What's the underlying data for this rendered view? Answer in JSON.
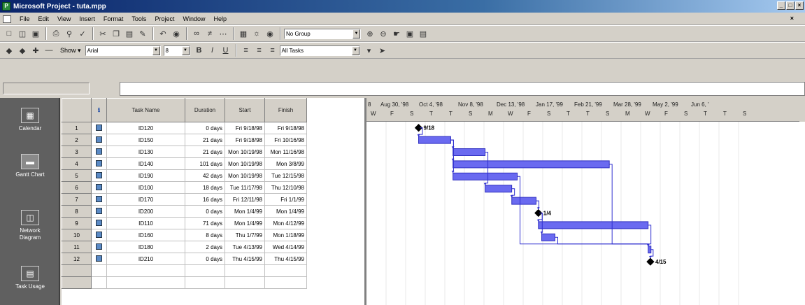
{
  "window": {
    "title": "Microsoft Project - tuta.mpp",
    "min": "_",
    "max": "□",
    "close": "×"
  },
  "menu": [
    "File",
    "Edit",
    "View",
    "Insert",
    "Format",
    "Tools",
    "Project",
    "Window",
    "Help"
  ],
  "toolbar1": {
    "group_combo": "No Group"
  },
  "toolbar2": {
    "show_label": "Show ▾",
    "font_combo": "Arial",
    "size_combo": "8",
    "filter_combo": "All Tasks"
  },
  "viewbar": [
    {
      "label": "Calendar",
      "icon": "calendar-icon"
    },
    {
      "label": "Gantt Chart",
      "icon": "gantt-chart-icon"
    },
    {
      "label": "Network Diagram",
      "icon": "network-diagram-icon"
    },
    {
      "label": "Task Usage",
      "icon": "task-usage-icon"
    }
  ],
  "columns": {
    "info": "ℹ",
    "name": "Task Name",
    "duration": "Duration",
    "start": "Start",
    "finish": "Finish"
  },
  "tasks": [
    {
      "id": "1",
      "name": "ID120",
      "duration": "0 days",
      "start": "Fri 9/18/98",
      "finish": "Fri 9/18/98"
    },
    {
      "id": "2",
      "name": "ID150",
      "duration": "21 days",
      "start": "Fri 9/18/98",
      "finish": "Fri 10/16/98"
    },
    {
      "id": "3",
      "name": "ID130",
      "duration": "21 days",
      "start": "Mon 10/19/98",
      "finish": "Mon 11/16/98"
    },
    {
      "id": "4",
      "name": "ID140",
      "duration": "101 days",
      "start": "Mon 10/19/98",
      "finish": "Mon 3/8/99"
    },
    {
      "id": "5",
      "name": "ID190",
      "duration": "42 days",
      "start": "Mon 10/19/98",
      "finish": "Tue 12/15/98"
    },
    {
      "id": "6",
      "name": "ID100",
      "duration": "18 days",
      "start": "Tue 11/17/98",
      "finish": "Thu 12/10/98"
    },
    {
      "id": "7",
      "name": "ID170",
      "duration": "16 days",
      "start": "Fri 12/11/98",
      "finish": "Fri 1/1/99"
    },
    {
      "id": "8",
      "name": "ID200",
      "duration": "0 days",
      "start": "Mon 1/4/99",
      "finish": "Mon 1/4/99"
    },
    {
      "id": "9",
      "name": "ID110",
      "duration": "71 days",
      "start": "Mon 1/4/99",
      "finish": "Mon 4/12/99"
    },
    {
      "id": "10",
      "name": "ID160",
      "duration": "8 days",
      "start": "Thu 1/7/99",
      "finish": "Mon 1/18/99"
    },
    {
      "id": "11",
      "name": "ID180",
      "duration": "2 days",
      "start": "Tue 4/13/99",
      "finish": "Wed 4/14/99"
    },
    {
      "id": "12",
      "name": "ID210",
      "duration": "0 days",
      "start": "Thu 4/15/99",
      "finish": "Thu 4/15/99"
    }
  ],
  "timescale_major": [
    "8",
    "Aug 30, '98",
    "Oct 4, '98",
    "Nov 8, '98",
    "Dec 13, '98",
    "Jan 17, '99",
    "Feb 21, '99",
    "Mar 28, '99",
    "May 2, '99",
    "Jun 6, '"
  ],
  "timescale_minor": [
    "W",
    "F",
    "S",
    "T",
    "T",
    "S",
    "M",
    "W",
    "F",
    "S",
    "T",
    "T",
    "S",
    "M",
    "W",
    "F",
    "S",
    "T",
    "T",
    "S"
  ],
  "milestones": {
    "first": "9/18",
    "mid": "1/4",
    "last": "4/15"
  },
  "colors": {
    "bar": "#6a6af0",
    "bar_border": "#3030c0",
    "link": "#3030d0",
    "titlebar": "#0a246a"
  }
}
